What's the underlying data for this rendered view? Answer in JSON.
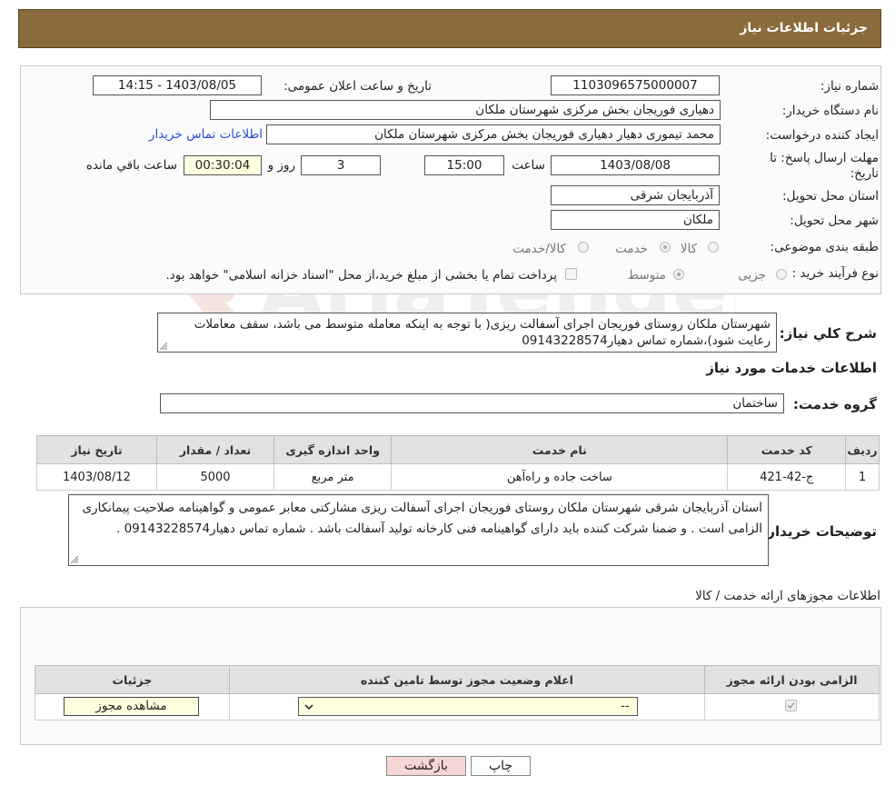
{
  "header": {
    "title": "جزئیات اطلاعات نیاز"
  },
  "fields": {
    "need_number_label": "شماره نیاز:",
    "need_number": "1103096575000007",
    "announce_label": "تاریخ و ساعت اعلان عمومی:",
    "announce_value": "1403/08/05 - 14:15",
    "buyer_org_label": "نام دستگاه خریدار:",
    "buyer_org": "دهیاری فوریجان بخش مرکزی شهرستان ملکان",
    "requester_label": "ایجاد کننده درخواست:",
    "requester": "محمد تیموری دهیار دهیاری فوریجان بخش مرکزی شهرستان ملکان",
    "buyer_contact_link": "اطلاعات تماس خریدار",
    "deadline_label": "مهلت ارسال پاسخ: تا تاریخ:",
    "deadline_date": "1403/08/08",
    "time_label": "ساعت",
    "deadline_time": "15:00",
    "days": "3",
    "days_label": "روز و",
    "remaining_time": "00:30:04",
    "remaining_label": "ساعت باقي مانده",
    "province_label": "استان محل تحویل:",
    "province": "آذربایجان شرقی",
    "city_label": "شهر محل تحویل:",
    "city": "ملکان",
    "category_label": "طبقه بندی موضوعی:",
    "category_options": [
      "کالا",
      "خدمت",
      "کالا/خدمت"
    ],
    "purchase_type_label": "نوع فرآیند خرید :",
    "purchase_options": [
      "جزیی",
      "متوسط"
    ],
    "purchase_note": "پرداخت تمام یا بخشی از مبلغ خرید،از محل \"اسناد خزانه اسلامی\" خواهد بود."
  },
  "summary": {
    "label": "شرح کلي نياز:",
    "text": "شهرستان ملکان روستای فوریجان اجرای آسفالت ریزی( با توجه به اینکه معامله متوسط می باشد، سقف معاملات رعایت شود)،شماره تماس دهیار09143228574"
  },
  "services": {
    "section_title": "اطلاعات خدمات مورد نیاز",
    "group_label": "گروه خدمت:",
    "group_value": "ساختمان",
    "columns": [
      "ردیف",
      "کد خدمت",
      "نام خدمت",
      "واحد اندازه گیری",
      "تعداد / مقدار",
      "تاریخ نیاز"
    ],
    "rows": [
      [
        "1",
        "ج-42-421",
        "ساخت جاده و راه‌آهن",
        "متر مربع",
        "5000",
        "1403/08/12"
      ]
    ]
  },
  "buyer_notes": {
    "label": "توضیحات خریدار:",
    "text": "استان آذربایجان شرقی شهرستان ملکان روستای فوریجان اجرای آسفالت ریزی مشارکتی معابر عمومی  و گواهینامه صلاحیت پیمانکاری الزامی است . و ضمنا شرکت کننده باید دارای گواهینامه فنی کارخانه تولید آسفالت باشد . شماره تماس دهیار09143228574 ."
  },
  "permits": {
    "section_title": "اطلاعات مجوزهای ارائه خدمت / کالا",
    "columns": [
      "الزامی بودن ارائه مجوز",
      "اعلام وضعیت مجوز توسط تامین کننده",
      "جزئیات"
    ],
    "select_value": "--",
    "view_button": "مشاهده مجوز"
  },
  "actions": {
    "print": "چاپ",
    "back": "بازگشت"
  },
  "watermark": {
    "text": "AriaTender.neT"
  },
  "colors": {
    "header_bg": "#8b6a3c",
    "link": "#2a4fcf",
    "back_btn": "#f7d6d6",
    "print_btn": "#ffffff"
  }
}
